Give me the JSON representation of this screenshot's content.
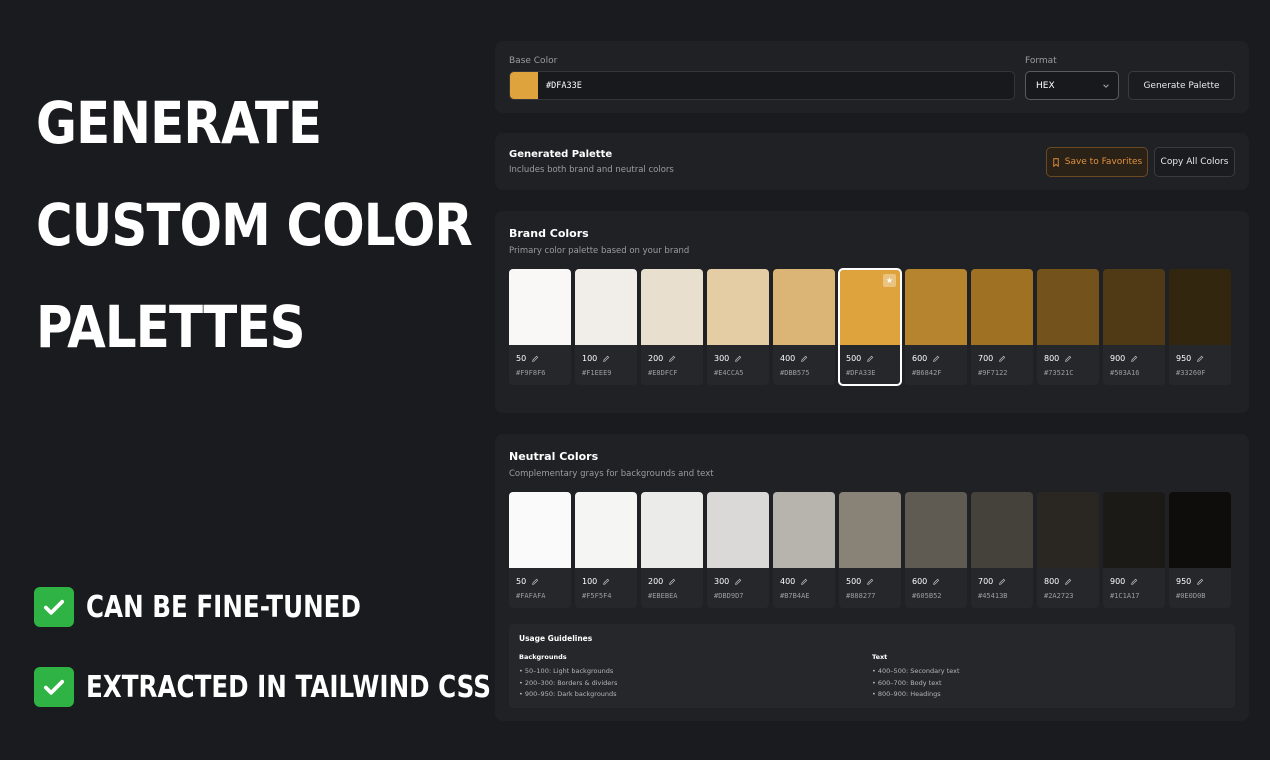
{
  "hero": {
    "lines": [
      "GENERATE",
      "CUSTOM COLOR",
      "PALETTES"
    ],
    "features": [
      "CAN BE FINE-TUNED",
      "EXTRACTED IN TAILWIND CSS"
    ]
  },
  "base": {
    "label": "Base Color",
    "value": "#DFA33E",
    "swatch_color": "#DFA33E",
    "format_label": "Format",
    "format_value": "HEX",
    "generate_label": "Generate Palette"
  },
  "generated": {
    "title": "Generated Palette",
    "subtitle": "Includes both brand and neutral colors",
    "save_label": "Save to Favorites",
    "copy_label": "Copy All Colors"
  },
  "brand": {
    "title": "Brand Colors",
    "subtitle": "Primary color palette based on your brand",
    "swatches": [
      {
        "shade": "50",
        "hex": "#F9F8F6",
        "color": "#F9F8F6"
      },
      {
        "shade": "100",
        "hex": "#F1EEE9",
        "color": "#F1EEE9"
      },
      {
        "shade": "200",
        "hex": "#E8DFCF",
        "color": "#E8DFCF"
      },
      {
        "shade": "300",
        "hex": "#E4CCA5",
        "color": "#E4CCA5"
      },
      {
        "shade": "400",
        "hex": "#DBB575",
        "color": "#DBB575"
      },
      {
        "shade": "500",
        "hex": "#DFA33E",
        "color": "#DFA33E"
      },
      {
        "shade": "600",
        "hex": "#B6842F",
        "color": "#B6842F"
      },
      {
        "shade": "700",
        "hex": "#9F7122",
        "color": "#9F7122"
      },
      {
        "shade": "800",
        "hex": "#73521C",
        "color": "#73521C"
      },
      {
        "shade": "900",
        "hex": "#503A16",
        "color": "#503A16"
      },
      {
        "shade": "950",
        "hex": "#33260F",
        "color": "#33260F"
      }
    ]
  },
  "neutral": {
    "title": "Neutral Colors",
    "subtitle": "Complementary grays for backgrounds and text",
    "swatches": [
      {
        "shade": "50",
        "hex": "#FAFAFA",
        "color": "#FAFAFA"
      },
      {
        "shade": "100",
        "hex": "#F5F5F4",
        "color": "#F5F5F4"
      },
      {
        "shade": "200",
        "hex": "#EBEBEA",
        "color": "#EBEBEA"
      },
      {
        "shade": "300",
        "hex": "#DBD9D7",
        "color": "#DBD9D7"
      },
      {
        "shade": "400",
        "hex": "#B7B4AE",
        "color": "#B7B4AE"
      },
      {
        "shade": "500",
        "hex": "#888277",
        "color": "#888277"
      },
      {
        "shade": "600",
        "hex": "#605B52",
        "color": "#605B52"
      },
      {
        "shade": "700",
        "hex": "#45413B",
        "color": "#45413B"
      },
      {
        "shade": "800",
        "hex": "#2A2723",
        "color": "#2A2723"
      },
      {
        "shade": "900",
        "hex": "#1C1A17",
        "color": "#1C1A17"
      },
      {
        "shade": "950",
        "hex": "#0E0D0B",
        "color": "#0E0D0B"
      }
    ]
  },
  "guidelines": {
    "title": "Usage Guidelines",
    "backgrounds_title": "Backgrounds",
    "backgrounds": [
      "• 50–100: Light backgrounds",
      "• 200–300: Borders & dividers",
      "• 900–950: Dark backgrounds"
    ],
    "text_title": "Text",
    "text": [
      "• 400–500: Secondary text",
      "• 600–700: Body text",
      "• 800–900: Headings"
    ]
  },
  "colors": {
    "accent": "#DFA33E",
    "check_green": "#2FB344",
    "save_accent": "#E0913F"
  },
  "icons": [
    "check-icon",
    "chevron-down-icon",
    "bookmark-icon",
    "pencil-icon",
    "star-icon"
  ]
}
